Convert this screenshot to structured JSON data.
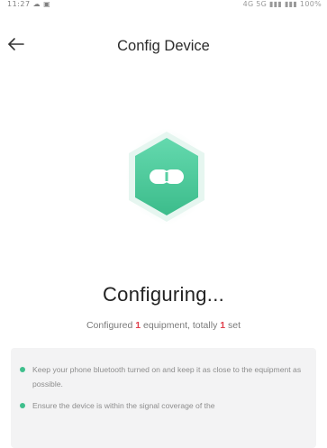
{
  "status_bar": {
    "time_text": "11:27 ☁ ▣",
    "indicators_text": "4G 5G ▮▮▮ ▮▮▮ 100%"
  },
  "header": {
    "title": "Config Device",
    "back_icon": "arrow-left-icon"
  },
  "device_icon": {
    "name": "link-hexagon-icon",
    "colors": {
      "hex_top": "#5fd6aa",
      "hex_bottom": "#3fbf8d",
      "glow": "#e3f5ee",
      "symbol": "#ffffff"
    }
  },
  "configuring": {
    "title": "Configuring...",
    "prefix": "Configured",
    "configured_count": "1",
    "middle": "equipment, totally",
    "total_count": "1",
    "suffix": "set",
    "count_color": "#e0414e"
  },
  "tips": {
    "bullet_color": "#3fbf8d",
    "items": [
      {
        "text": "Keep your phone bluetooth turned on and keep it as close to the equipment as possible."
      },
      {
        "text": "Ensure the device is within the signal coverage of the"
      }
    ]
  }
}
